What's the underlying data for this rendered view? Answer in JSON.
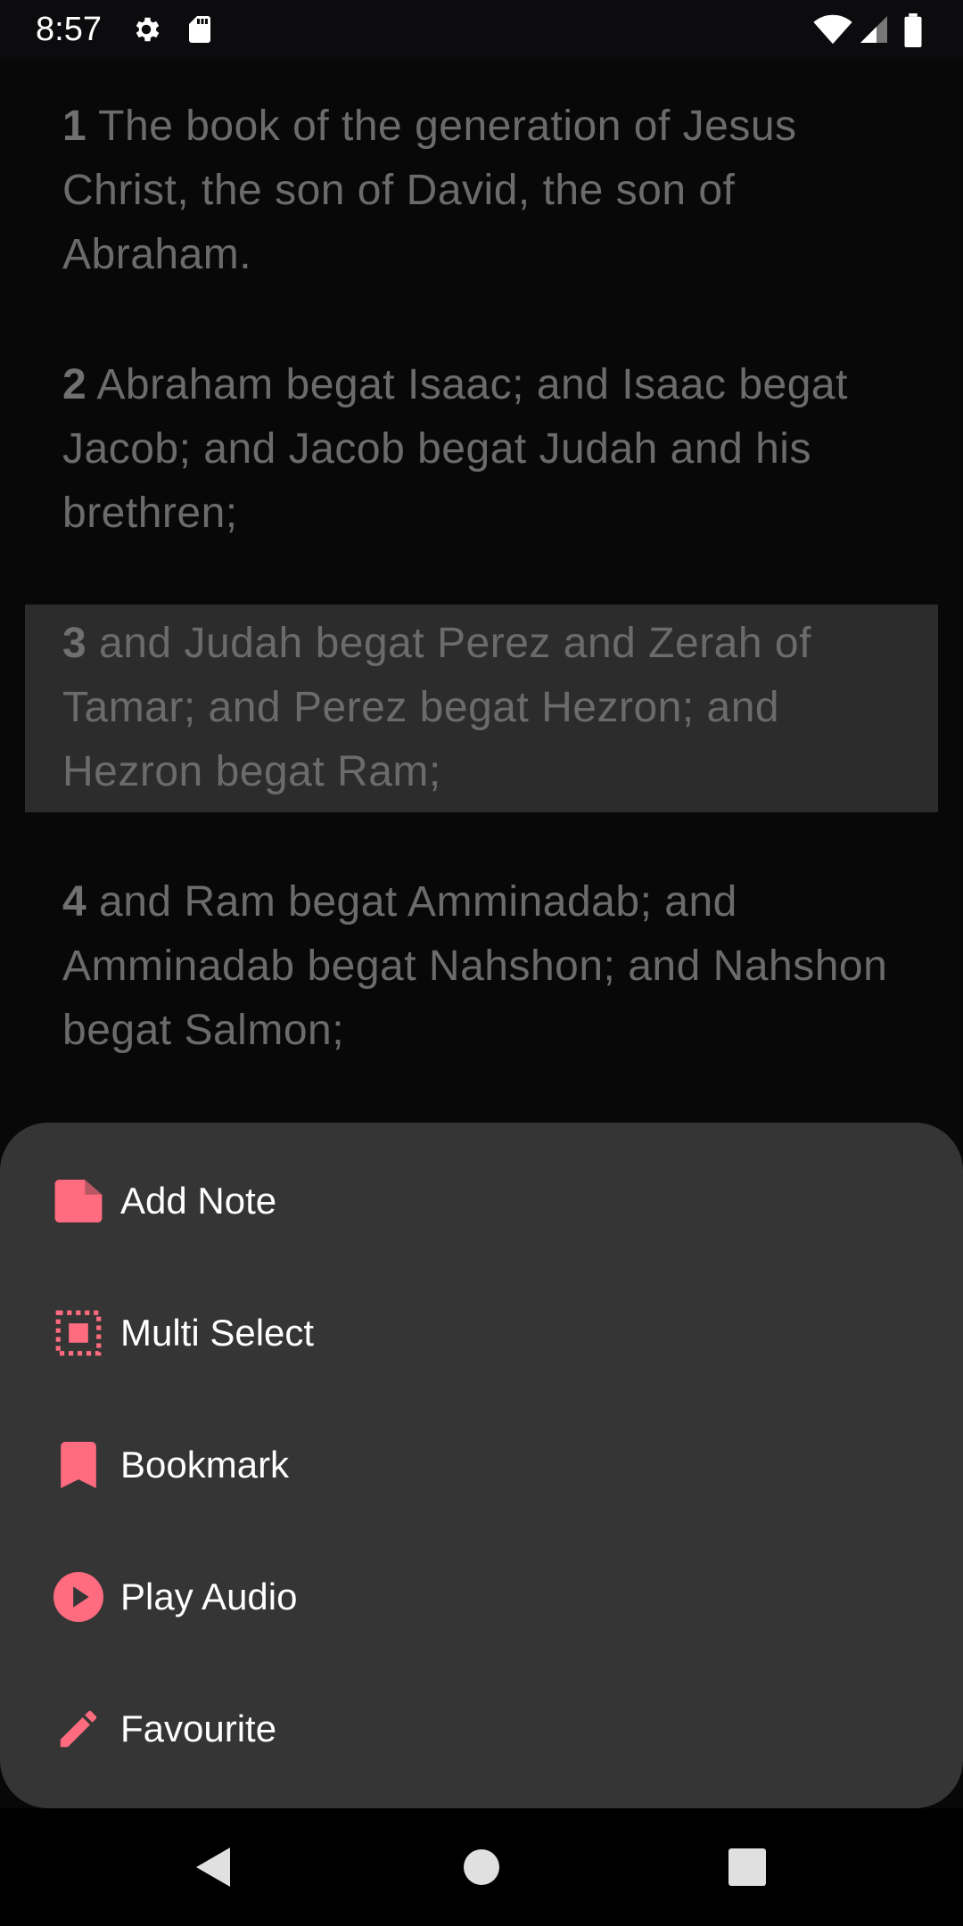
{
  "status_bar": {
    "time": "8:57",
    "icons": [
      "gear-icon",
      "sd-card-icon",
      "wifi-icon",
      "signal-icon",
      "battery-icon"
    ]
  },
  "verses": [
    {
      "number": "1",
      "text": " The book of the generation of Jesus Christ, the son of David, the son of Abraham.",
      "selected": false
    },
    {
      "number": "2",
      "text": " Abraham begat Isaac; and Isaac begat Jacob; and Jacob begat Judah and his brethren;",
      "selected": false
    },
    {
      "number": "3",
      "text": " and Judah begat Perez and Zerah of Tamar; and Perez begat Hezron; and Hezron begat Ram;",
      "selected": true
    },
    {
      "number": "4",
      "text": " and Ram begat Amminadab; and Amminadab begat Nahshon; and Nahshon begat Salmon;",
      "selected": false
    }
  ],
  "menu": {
    "items": [
      {
        "label": "Add Note",
        "icon": "note-icon"
      },
      {
        "label": "Multi Select",
        "icon": "multi-select-icon"
      },
      {
        "label": "Bookmark",
        "icon": "bookmark-icon"
      },
      {
        "label": "Play Audio",
        "icon": "play-circle-icon"
      },
      {
        "label": "Favourite",
        "icon": "pencil-icon"
      }
    ]
  },
  "nav_bar": {
    "buttons": [
      "back-icon",
      "home-icon",
      "recents-icon"
    ]
  },
  "colors": {
    "accent": "#ff6b7f",
    "sheet_background": "#353535",
    "selected_verse_background": "#2c2c2c",
    "verse_text": "#6b6b6b"
  }
}
